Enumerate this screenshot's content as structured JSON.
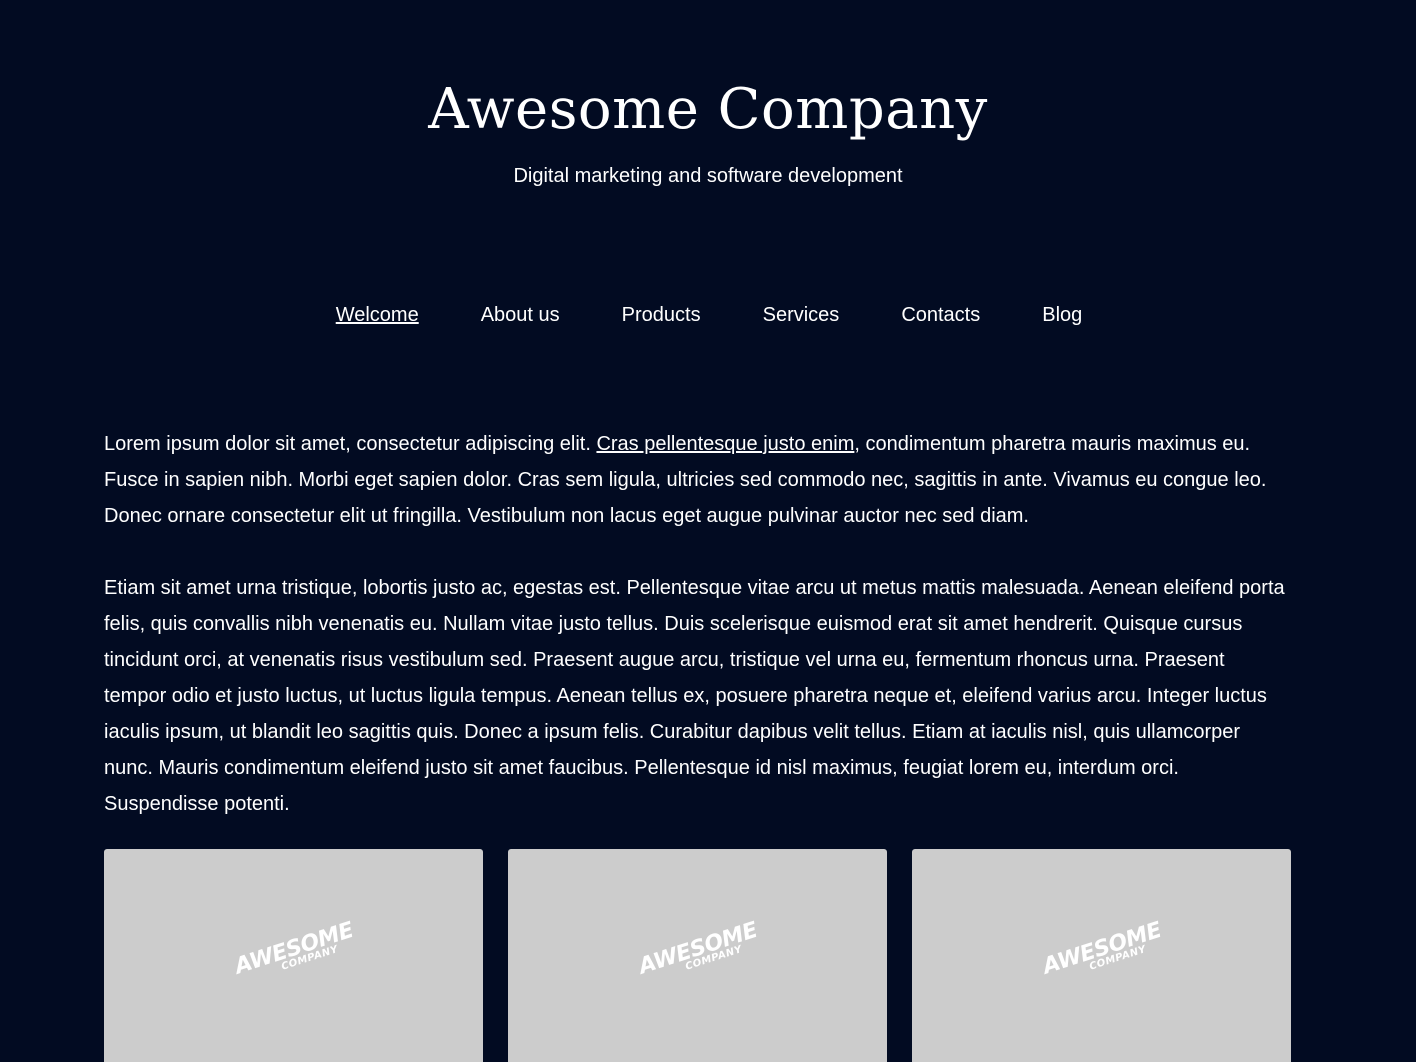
{
  "header": {
    "title": "Awesome Company",
    "tagline": "Digital marketing and software development"
  },
  "nav": {
    "items": [
      {
        "label": "Welcome",
        "active": true
      },
      {
        "label": "About us",
        "active": false
      },
      {
        "label": "Products",
        "active": false
      },
      {
        "label": "Services",
        "active": false
      },
      {
        "label": "Contacts",
        "active": false
      },
      {
        "label": "Blog",
        "active": false
      }
    ]
  },
  "main": {
    "p1_before": "Lorem ipsum dolor sit amet, consectetur adipiscing elit. ",
    "p1_link": "Cras pellentesque justo enim",
    "p1_after": ", condimentum pharetra mauris maximus eu. Fusce in sapien nibh. Morbi eget sapien dolor. Cras sem ligula, ultricies sed commodo nec, sagittis in ante. Vivamus eu congue leo. Donec ornare consectetur elit ut fringilla. Vestibulum non lacus eget augue pulvinar auctor nec sed diam.",
    "p2": "Etiam sit amet urna tristique, lobortis justo ac, egestas est. Pellentesque vitae arcu ut metus mattis malesuada. Aenean eleifend porta felis, quis convallis nibh venenatis eu. Nullam vitae justo tellus. Duis scelerisque euismod erat sit amet hendrerit. Quisque cursus tincidunt orci, at venenatis risus vestibulum sed. Praesent augue arcu, tristique vel urna eu, fermentum rhoncus urna. Praesent tempor odio et justo luctus, ut luctus ligula tempus. Aenean tellus ex, posuere pharetra neque et, eleifend varius arcu. Integer luctus iaculis ipsum, ut blandit leo sagittis quis. Donec a ipsum felis. Curabitur dapibus velit tellus. Etiam at iaculis nisl, quis ullamcorper nunc. Mauris condimentum eleifend justo sit amet faucibus. Pellentesque id nisl maximus, feugiat lorem eu, interdum orci. Suspendisse potenti."
  },
  "cards": [
    {
      "logo_top": "AWESOME",
      "logo_bottom": "COMPANY"
    },
    {
      "logo_top": "AWESOME",
      "logo_bottom": "COMPANY"
    },
    {
      "logo_top": "AWESOME",
      "logo_bottom": "COMPANY"
    }
  ],
  "colors": {
    "background": "#020b22",
    "text": "#ffffff",
    "card_placeholder": "#cccccc"
  }
}
